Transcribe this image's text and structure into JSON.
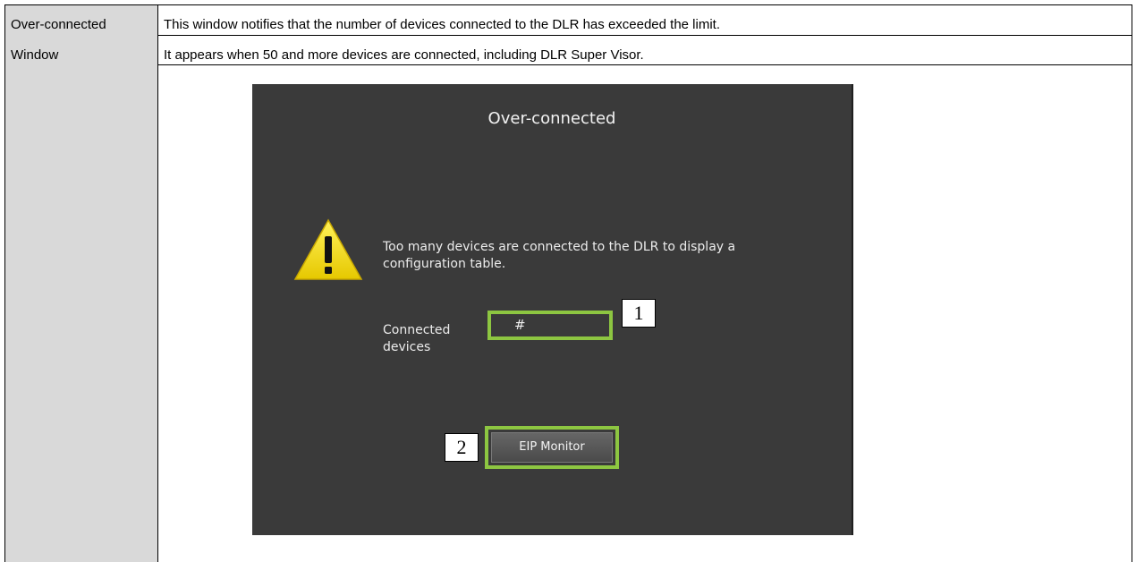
{
  "row_label": {
    "line1": "Over-connected",
    "line2": "Window"
  },
  "description": {
    "line1": "This window notifies that the number of devices connected to the DLR has exceeded the limit.",
    "line2": "It appears when 50 and more devices are connected, including DLR Super Visor."
  },
  "dialog": {
    "title": "Over-connected",
    "message": "Too many devices are connected to the DLR to display a configuration table.",
    "connected_label": "Connected devices",
    "connected_value": "#",
    "eip_button_label": "EIP Monitor",
    "highlight_color": "#8dc641"
  },
  "callouts": {
    "connected": "1",
    "eip": "2"
  }
}
